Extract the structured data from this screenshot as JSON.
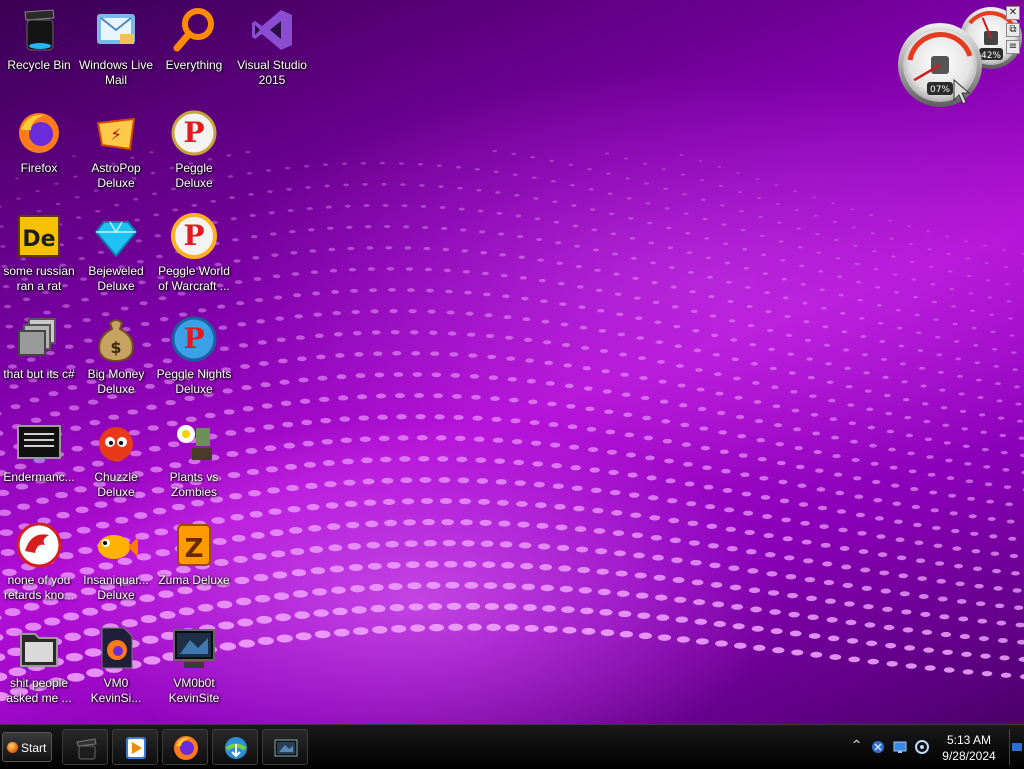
{
  "desktop": {
    "icons": [
      {
        "label": "Recycle Bin",
        "icon": "recycle-bin-icon"
      },
      {
        "label": "Windows Live\nMail",
        "icon": "mail-icon"
      },
      {
        "label": "Everything",
        "icon": "search-icon"
      },
      {
        "label": "Visual Studio\n2015",
        "icon": "visual-studio-icon"
      },
      {
        "label": "Firefox",
        "icon": "firefox-icon"
      },
      {
        "label": "AstroPop\nDeluxe",
        "icon": "astropop-icon"
      },
      {
        "label": "Peggle Deluxe",
        "icon": "peggle-icon"
      },
      {
        "label": "some russian\nran a rat",
        "icon": "de-app-icon"
      },
      {
        "label": "Bejeweled\nDeluxe",
        "icon": "gem-icon"
      },
      {
        "label": "Peggle World\nof Warcraft ...",
        "icon": "peggle-wow-icon"
      },
      {
        "label": "that but its c#",
        "icon": "windows-stack-icon"
      },
      {
        "label": "Big Money\nDeluxe",
        "icon": "money-bag-icon"
      },
      {
        "label": "Peggle Nights\nDeluxe",
        "icon": "peggle-nights-icon"
      },
      {
        "label": "Endermanc...",
        "icon": "console-icon"
      },
      {
        "label": "Chuzzle\nDeluxe",
        "icon": "chuzzle-icon"
      },
      {
        "label": "Plants vs\nZombies",
        "icon": "plants-vs-zombies-icon"
      },
      {
        "label": "none of you\nretards kno...",
        "icon": "dragon-icon"
      },
      {
        "label": "Insaniquar...\nDeluxe",
        "icon": "fish-icon"
      },
      {
        "label": "Zuma Deluxe",
        "icon": "zuma-icon"
      },
      {
        "label": "shit people\nasked me ...",
        "icon": "folder-icon"
      },
      {
        "label": "VM0\nKevinSi...",
        "icon": "firefox-file-icon"
      },
      {
        "label": "VM0b0t\nKevinSite",
        "icon": "video-icon"
      }
    ]
  },
  "gadget": {
    "cpu_label": "07%",
    "memory_label": "42%",
    "cpu_value": 0.07,
    "memory_value": 0.42,
    "tools": [
      "✕",
      "⧉",
      "≡"
    ]
  },
  "taskbar": {
    "start_label": "Start",
    "pinned": [
      {
        "name": "taskbar-recycle-bin",
        "icon": "recycle-bin-icon"
      },
      {
        "name": "taskbar-media-player",
        "icon": "media-player-icon"
      },
      {
        "name": "taskbar-firefox",
        "icon": "firefox-icon"
      },
      {
        "name": "taskbar-download-manager",
        "icon": "download-manager-icon"
      },
      {
        "name": "taskbar-video-app",
        "icon": "video-icon"
      }
    ]
  },
  "tray": {
    "expand_glyph": "^",
    "icons": [
      "network-icon",
      "display-icon",
      "volume-icon"
    ],
    "time": "5:13 AM",
    "date": "9/28/2024"
  },
  "colors": {
    "wallpaper_primary": "#9b00c8",
    "wallpaper_dots": "#f3a9ff",
    "taskbar": "#0a0a0a",
    "label_text": "#ffffff"
  }
}
